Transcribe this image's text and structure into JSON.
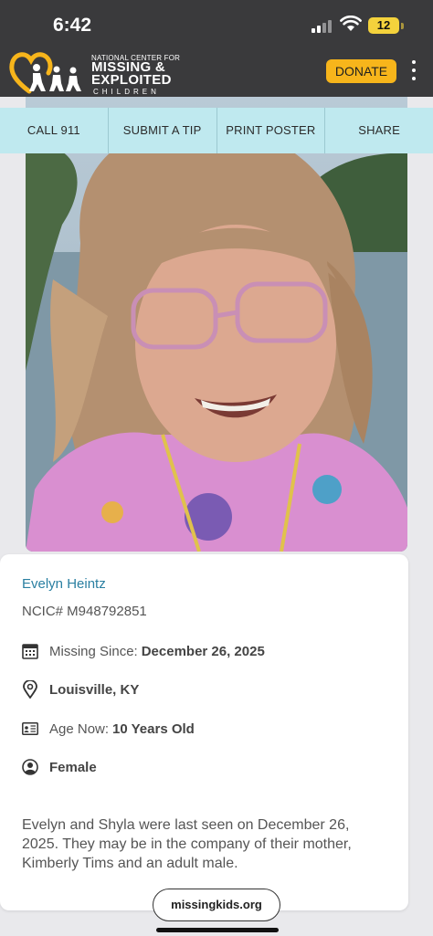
{
  "status_bar": {
    "time": "6:42",
    "battery": "12"
  },
  "header": {
    "logo_top": "NATIONAL CENTER FOR",
    "logo_line1": "MISSING &",
    "logo_line2": "EXPLOITED",
    "logo_sub": "CHILDREN",
    "donate_label": "DONATE"
  },
  "actions": {
    "call": "CALL 911",
    "tip": "SUBMIT A TIP",
    "print": "PRINT POSTER",
    "share": "SHARE"
  },
  "child": {
    "name": "Evelyn Heintz",
    "ncic": "NCIC# M948792851",
    "missing_since_label": "Missing Since:",
    "missing_since_value": "December 26, 2025",
    "location": "Louisville, KY",
    "age_label": "Age Now:",
    "age_value": "10 Years Old",
    "sex": "Female",
    "description": "Evelyn and Shyla were last seen on December 26, 2025. They may be in the company of their mother, Kimberly Tims and an adult male."
  },
  "footer": {
    "site": "missingkids.org"
  },
  "colors": {
    "header_bg": "#3a3a3c",
    "donate": "#f7b51b",
    "action_bar": "#bfe9ef",
    "name_link": "#2a7fa1",
    "logo_heart": "#f7b51b"
  },
  "icons": [
    "calendar-icon",
    "location-pin-icon",
    "id-card-icon",
    "person-icon",
    "wifi-icon",
    "signal-icon",
    "battery-icon",
    "more-icon"
  ]
}
